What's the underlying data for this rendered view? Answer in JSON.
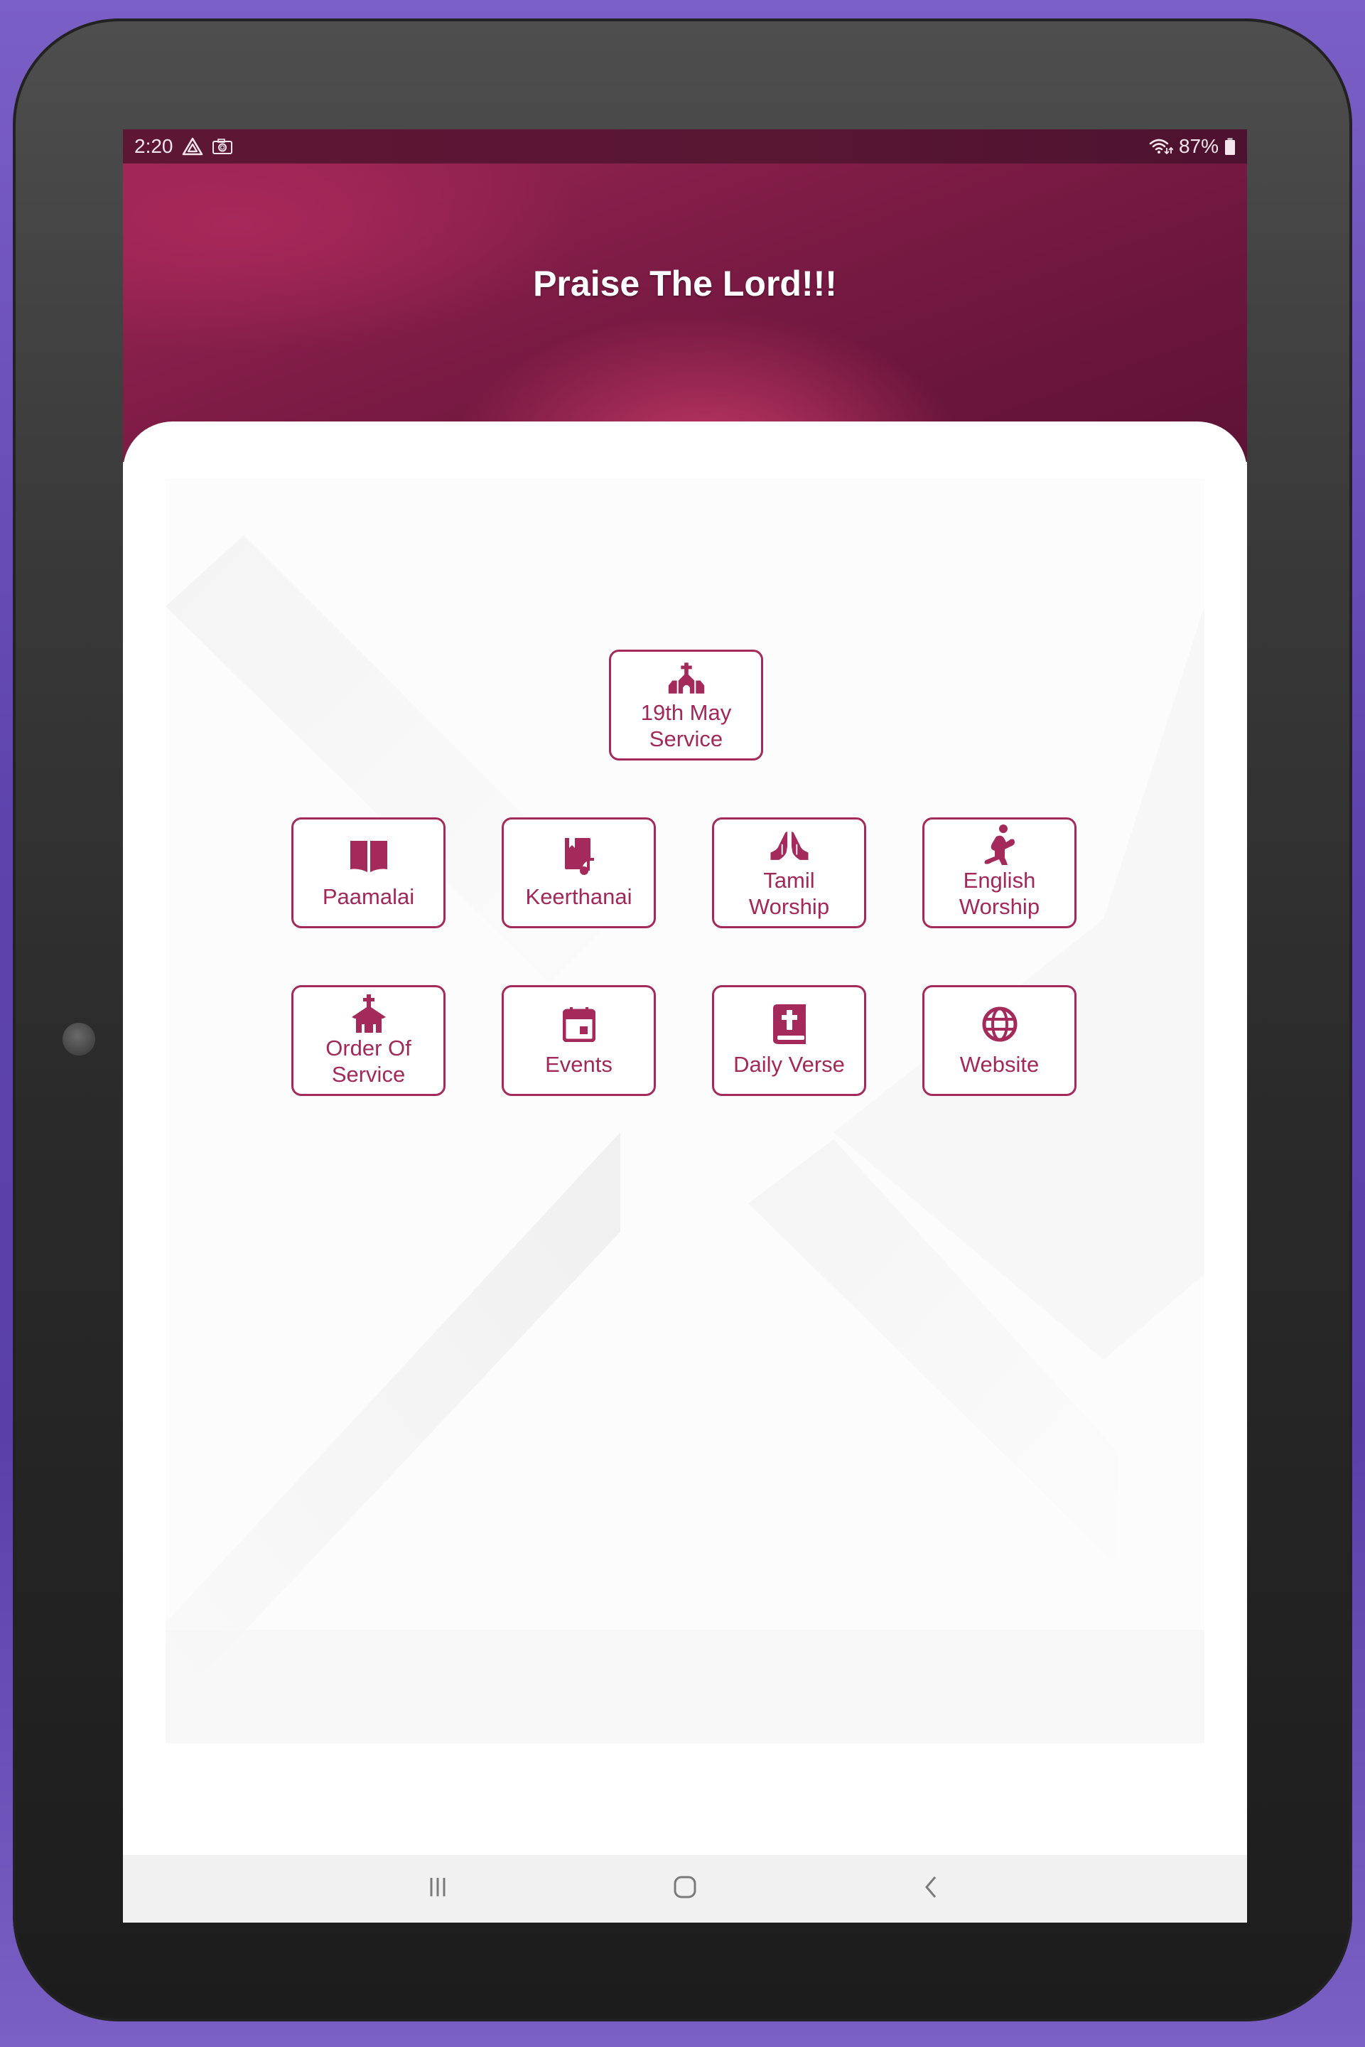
{
  "status_bar": {
    "time": "2:20",
    "left_icons": [
      "drive-icon",
      "camera-icon"
    ],
    "right_icons": [
      "wifi-icon",
      "battery-icon"
    ],
    "battery_percent": "87%"
  },
  "header": {
    "title": "Praise The Lord!!!"
  },
  "featured": {
    "label": "19th May\nService",
    "icon": "church-icon"
  },
  "menu": [
    {
      "label": "Paamalai",
      "icon": "book-open-icon"
    },
    {
      "label": "Keerthanai",
      "icon": "music-book-icon"
    },
    {
      "label": "Tamil\nWorship",
      "icon": "praying-hands-icon"
    },
    {
      "label": "English\nWorship",
      "icon": "kneeling-prayer-icon"
    },
    {
      "label": "Order Of\nService",
      "icon": "chapel-icon"
    },
    {
      "label": "Events",
      "icon": "calendar-icon"
    },
    {
      "label": "Daily Verse",
      "icon": "bible-icon"
    },
    {
      "label": "Website",
      "icon": "globe-icon"
    }
  ],
  "nav_bar": {
    "buttons": [
      "recent-apps",
      "home",
      "back"
    ]
  },
  "colors": {
    "accent": "#a52a5c",
    "header_dark": "#5e1236",
    "header_light": "#c43a66",
    "device_case": "#6a4fb5"
  }
}
